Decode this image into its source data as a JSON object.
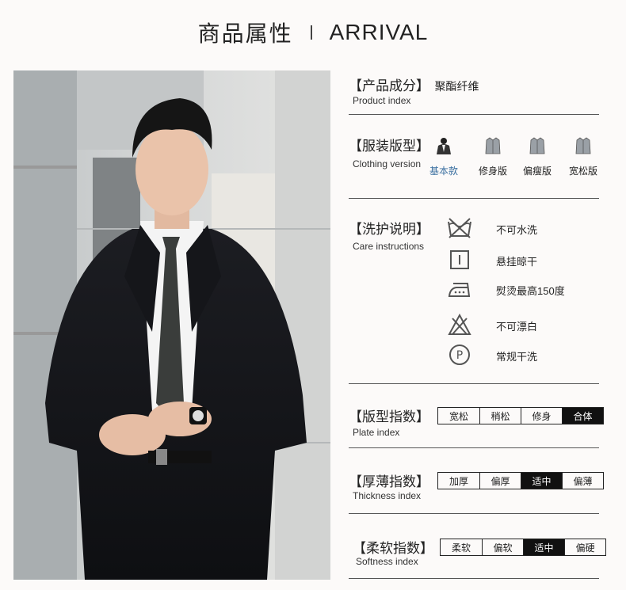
{
  "header": {
    "title_cn": "商品属性",
    "title_en": "ARRIVAL"
  },
  "material": {
    "title": "【产品成分】",
    "value": "聚酯纤维",
    "subtitle": "Product index"
  },
  "version": {
    "title": "【服装版型】",
    "subtitle": "Clothing version",
    "options": [
      {
        "label": "基本款",
        "icon": "suit-model-icon",
        "active": true
      },
      {
        "label": "修身版",
        "icon": "shirt-icon",
        "active": false
      },
      {
        "label": "偏瘦版",
        "icon": "shirt-icon",
        "active": false
      },
      {
        "label": "宽松版",
        "icon": "shirt-icon",
        "active": false
      }
    ]
  },
  "care": {
    "title": "【洗护说明】",
    "subtitle": "Care instructions",
    "items": [
      {
        "icon": "no-wash-icon",
        "text": "不可水洗"
      },
      {
        "icon": "hang-dry-icon",
        "text": "悬挂晾干"
      },
      {
        "icon": "iron-icon",
        "text": "熨烫最高150度"
      },
      {
        "icon": "no-bleach-icon",
        "text": "不可漂白"
      },
      {
        "icon": "dry-clean-icon",
        "text": "常规干洗"
      }
    ]
  },
  "fit_index": {
    "title": "【版型指数】",
    "subtitle": "Plate index",
    "options": [
      "宽松",
      "稍松",
      "修身",
      "合体"
    ],
    "active": 3
  },
  "thickness_index": {
    "title": "【厚薄指数】",
    "subtitle": "Thickness index",
    "options": [
      "加厚",
      "偏厚",
      "适中",
      "偏薄"
    ],
    "active": 2
  },
  "softness_index": {
    "title": "【柔软指数】",
    "subtitle": "Softness index",
    "options": [
      "柔软",
      "偏软",
      "适中",
      "偏硬"
    ],
    "active": 2
  },
  "colors": {
    "background": "#fcfaf9",
    "active_cell": "#111111",
    "active_version_label": "#3a6fa0"
  }
}
